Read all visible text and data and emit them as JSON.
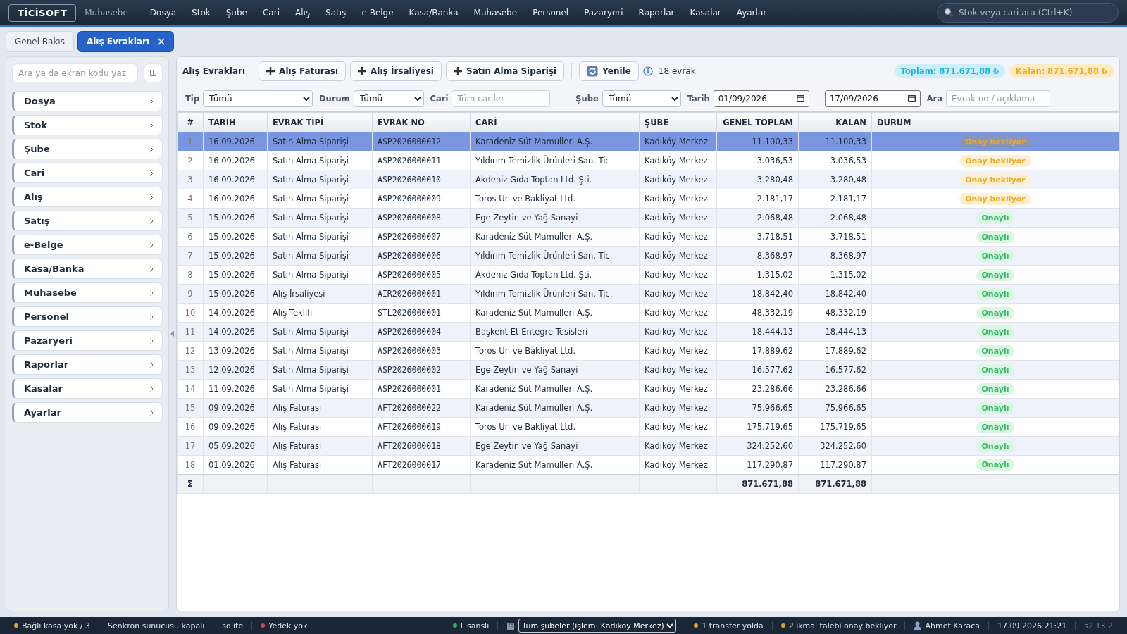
{
  "topbar": {
    "logo": "TİCİSOFT",
    "module": "Muhasebe",
    "menu": [
      "Dosya",
      "Stok",
      "Şube",
      "Cari",
      "Alış",
      "Satış",
      "e-Belge",
      "Kasa/Banka",
      "Muhasebe",
      "Personel",
      "Pazaryeri",
      "Raporlar",
      "Kasalar",
      "Ayarlar"
    ],
    "search": {
      "placeholder": "Stok veya cari ara (Ctrl+K)"
    }
  },
  "tabs": [
    {
      "label": "Genel Bakış",
      "selected": false,
      "closable": false
    },
    {
      "label": "Alış Evrakları",
      "selected": true,
      "closable": true
    }
  ],
  "sidebar": {
    "search": {
      "placeholder": "Ara ya da ekran kodu yaz"
    },
    "items": [
      "Dosya",
      "Stok",
      "Şube",
      "Cari",
      "Alış",
      "Satış",
      "e-Belge",
      "Kasa/Banka",
      "Muhasebe",
      "Personel",
      "Pazaryeri",
      "Raporlar",
      "Kasalar",
      "Ayarlar"
    ]
  },
  "toolbar": {
    "title": "Alış Evrakları",
    "buttons": [
      {
        "label": "Alış Faturası",
        "kind": "add"
      },
      {
        "label": "Alış İrsaliyesi",
        "kind": "add"
      },
      {
        "label": "Satın Alma Siparişi",
        "kind": "add"
      },
      {
        "label": "Yenile",
        "kind": "refresh"
      }
    ],
    "count": "18 evrak",
    "total": "Toplam: 871.671,88 ₺",
    "remaining": "Kalan: 871.671,88 ₺"
  },
  "filters": [
    {
      "label": "Tip",
      "kind": "select",
      "value": "Tümü"
    },
    {
      "label": "Durum",
      "kind": "select",
      "value": "Tümü"
    },
    {
      "label": "Cari",
      "kind": "text",
      "placeholder": "Tüm cariler"
    },
    {
      "label": "Şube",
      "kind": "select",
      "value": "Tümü"
    },
    {
      "label": "Tarih",
      "kind": "daterange",
      "from": "01/09/2026",
      "to": "17/09/2026",
      "separator": "—"
    },
    {
      "label": "Ara",
      "kind": "text",
      "placeholder": "Evrak no / açıklama"
    }
  ],
  "table": {
    "columns": [
      "#",
      "TARİH",
      "EVRAK TİPİ",
      "EVRAK NO",
      "CARİ",
      "ŞUBE",
      "GENEL TOPLAM",
      "KALAN",
      "DURUM"
    ],
    "rows": [
      {
        "no": "1",
        "date": "16.09.2026",
        "type": "Satın Alma Siparişi",
        "doc": "ASP2026000012",
        "party": "Karadeniz Süt Mamulleri A.Ş.",
        "branch": "Kadıköy Merkez",
        "total": "11.100,33",
        "remaining": "11.100,33",
        "status": {
          "text": "Onay bekliyor",
          "kind": "pending"
        },
        "selected": true
      },
      {
        "no": "2",
        "date": "16.09.2026",
        "type": "Satın Alma Siparişi",
        "doc": "ASP2026000011",
        "party": "Yıldırım Temizlik Ürünleri San. Tic.",
        "branch": "Kadıköy Merkez",
        "total": "3.036,53",
        "remaining": "3.036,53",
        "status": {
          "text": "Onay bekliyor",
          "kind": "pending"
        },
        "selected": false
      },
      {
        "no": "3",
        "date": "16.09.2026",
        "type": "Satın Alma Siparişi",
        "doc": "ASP2026000010",
        "party": "Akdeniz Gıda Toptan Ltd. Şti.",
        "branch": "Kadıköy Merkez",
        "total": "3.280,48",
        "remaining": "3.280,48",
        "status": {
          "text": "Onay bekliyor",
          "kind": "pending"
        },
        "selected": false
      },
      {
        "no": "4",
        "date": "16.09.2026",
        "type": "Satın Alma Siparişi",
        "doc": "ASP2026000009",
        "party": "Toros Un ve Bakliyat Ltd.",
        "branch": "Kadıköy Merkez",
        "total": "2.181,17",
        "remaining": "2.181,17",
        "status": {
          "text": "Onay bekliyor",
          "kind": "pending"
        },
        "selected": false
      },
      {
        "no": "5",
        "date": "15.09.2026",
        "type": "Satın Alma Siparişi",
        "doc": "ASP2026000008",
        "party": "Ege Zeytin ve Yağ Sanayi",
        "branch": "Kadıköy Merkez",
        "total": "2.068,48",
        "remaining": "2.068,48",
        "status": {
          "text": "Onaylı",
          "kind": "approved"
        },
        "selected": false
      },
      {
        "no": "6",
        "date": "15.09.2026",
        "type": "Satın Alma Siparişi",
        "doc": "ASP2026000007",
        "party": "Karadeniz Süt Mamulleri A.Ş.",
        "branch": "Kadıköy Merkez",
        "total": "3.718,51",
        "remaining": "3.718,51",
        "status": {
          "text": "Onaylı",
          "kind": "approved"
        },
        "selected": false
      },
      {
        "no": "7",
        "date": "15.09.2026",
        "type": "Satın Alma Siparişi",
        "doc": "ASP2026000006",
        "party": "Yıldırım Temizlik Ürünleri San. Tic.",
        "branch": "Kadıköy Merkez",
        "total": "8.368,97",
        "remaining": "8.368,97",
        "status": {
          "text": "Onaylı",
          "kind": "approved"
        },
        "selected": false
      },
      {
        "no": "8",
        "date": "15.09.2026",
        "type": "Satın Alma Siparişi",
        "doc": "ASP2026000005",
        "party": "Akdeniz Gıda Toptan Ltd. Şti.",
        "branch": "Kadıköy Merkez",
        "total": "1.315,02",
        "remaining": "1.315,02",
        "status": {
          "text": "Onaylı",
          "kind": "approved"
        },
        "selected": false
      },
      {
        "no": "9",
        "date": "15.09.2026",
        "type": "Alış İrsaliyesi",
        "doc": "AIR2026000001",
        "party": "Yıldırım Temizlik Ürünleri San. Tic.",
        "branch": "Kadıköy Merkez",
        "total": "18.842,40",
        "remaining": "18.842,40",
        "status": {
          "text": "Onaylı",
          "kind": "approved"
        },
        "selected": false
      },
      {
        "no": "10",
        "date": "14.09.2026",
        "type": "Alış Teklifi",
        "doc": "STL2026000001",
        "party": "Karadeniz Süt Mamulleri A.Ş.",
        "branch": "Kadıköy Merkez",
        "total": "48.332,19",
        "remaining": "48.332,19",
        "status": {
          "text": "Onaylı",
          "kind": "approved"
        },
        "selected": false
      },
      {
        "no": "11",
        "date": "14.09.2026",
        "type": "Satın Alma Siparişi",
        "doc": "ASP2026000004",
        "party": "Başkent Et Entegre Tesisleri",
        "branch": "Kadıköy Merkez",
        "total": "18.444,13",
        "remaining": "18.444,13",
        "status": {
          "text": "Onaylı",
          "kind": "approved"
        },
        "selected": false
      },
      {
        "no": "12",
        "date": "13.09.2026",
        "type": "Satın Alma Siparişi",
        "doc": "ASP2026000003",
        "party": "Toros Un ve Bakliyat Ltd.",
        "branch": "Kadıköy Merkez",
        "total": "17.889,62",
        "remaining": "17.889,62",
        "status": {
          "text": "Onaylı",
          "kind": "approved"
        },
        "selected": false
      },
      {
        "no": "13",
        "date": "12.09.2026",
        "type": "Satın Alma Siparişi",
        "doc": "ASP2026000002",
        "party": "Ege Zeytin ve Yağ Sanayi",
        "branch": "Kadıköy Merkez",
        "total": "16.577,62",
        "remaining": "16.577,62",
        "status": {
          "text": "Onaylı",
          "kind": "approved"
        },
        "selected": false
      },
      {
        "no": "14",
        "date": "11.09.2026",
        "type": "Satın Alma Siparişi",
        "doc": "ASP2026000001",
        "party": "Karadeniz Süt Mamulleri A.Ş.",
        "branch": "Kadıköy Merkez",
        "total": "23.286,66",
        "remaining": "23.286,66",
        "status": {
          "text": "Onaylı",
          "kind": "approved"
        },
        "selected": false
      },
      {
        "no": "15",
        "date": "09.09.2026",
        "type": "Alış Faturası",
        "doc": "AFT2026000022",
        "party": "Karadeniz Süt Mamulleri A.Ş.",
        "branch": "Kadıköy Merkez",
        "total": "75.966,65",
        "remaining": "75.966,65",
        "status": {
          "text": "Onaylı",
          "kind": "approved"
        },
        "selected": false
      },
      {
        "no": "16",
        "date": "09.09.2026",
        "type": "Alış Faturası",
        "doc": "AFT2026000019",
        "party": "Toros Un ve Bakliyat Ltd.",
        "branch": "Kadıköy Merkez",
        "total": "175.719,65",
        "remaining": "175.719,65",
        "status": {
          "text": "Onaylı",
          "kind": "approved"
        },
        "selected": false
      },
      {
        "no": "17",
        "date": "05.09.2026",
        "type": "Alış Faturası",
        "doc": "AFT2026000018",
        "party": "Ege Zeytin ve Yağ Sanayi",
        "branch": "Kadıköy Merkez",
        "total": "324.252,60",
        "remaining": "324.252,60",
        "status": {
          "text": "Onaylı",
          "kind": "approved"
        },
        "selected": false
      },
      {
        "no": "18",
        "date": "01.09.2026",
        "type": "Alış Faturası",
        "doc": "AFT2026000017",
        "party": "Karadeniz Süt Mamulleri A.Ş.",
        "branch": "Kadıköy Merkez",
        "total": "117.290,87",
        "remaining": "117.290,87",
        "status": {
          "text": "Onaylı",
          "kind": "approved"
        },
        "selected": false
      }
    ],
    "footer": {
      "symbol": "Σ",
      "total": "871.671,88",
      "remaining": "871.671,88"
    }
  },
  "status_bar": [
    {
      "kind": "dot",
      "text": "Bağlı kasa yok / 3",
      "color": "#e0a030"
    },
    {
      "kind": "text",
      "text": "Senkron sunucusu kapalı"
    },
    {
      "kind": "text",
      "text": "sqlite"
    },
    {
      "kind": "dot",
      "text": "Yedek yok",
      "color": "#e04040"
    },
    {
      "kind": "spacer"
    },
    {
      "kind": "dot",
      "text": "Lisanslı",
      "color": "#30b050"
    },
    {
      "kind": "select",
      "text": "Tüm şubeler (işlem: Kadıköy Merkez)"
    },
    {
      "kind": "dot",
      "text": "1 transfer yolda",
      "color": "#e0a030"
    },
    {
      "kind": "dot",
      "text": "2 ikmal talebi onay bekliyor",
      "color": "#e0a030"
    },
    {
      "kind": "user",
      "text": "Ahmet Karaca"
    },
    {
      "kind": "text",
      "text": "17.09.2026 21:21"
    },
    {
      "kind": "version",
      "text": "s2.13.2"
    }
  ]
}
